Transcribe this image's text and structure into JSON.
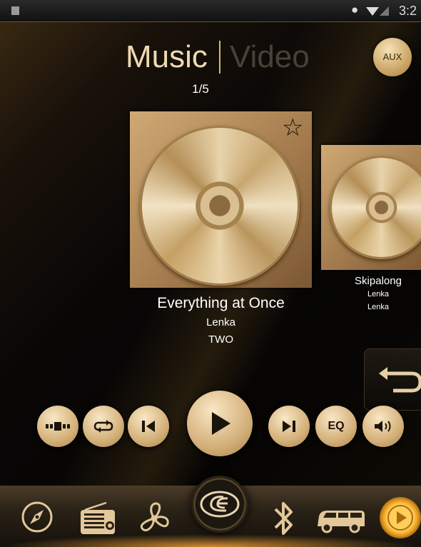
{
  "status_bar": {
    "clock": "3:2"
  },
  "header": {
    "tabs": [
      {
        "label": "Music",
        "active": true
      },
      {
        "label": "Video",
        "active": false
      }
    ],
    "page_indicator": "1/5",
    "aux_label": "AUX"
  },
  "albums": [
    {
      "title": "Everything at Once",
      "artist": "Lenka",
      "album": "TWO",
      "favorite": false
    },
    {
      "title": "Skipalong",
      "artist": "Lenka",
      "album": "Lenka"
    }
  ],
  "controls": {
    "eq_label": "EQ"
  },
  "bottom_nav": {
    "items": [
      "navigation-icon",
      "radio-icon",
      "fan-icon",
      "home-logo-icon",
      "bluetooth-icon",
      "vehicle-icon",
      "media-play-icon"
    ],
    "active": "media-play-icon"
  },
  "colors": {
    "accent_gold": "#d4b07a",
    "background": "#090706",
    "active_glow": "#ffcf5a"
  }
}
